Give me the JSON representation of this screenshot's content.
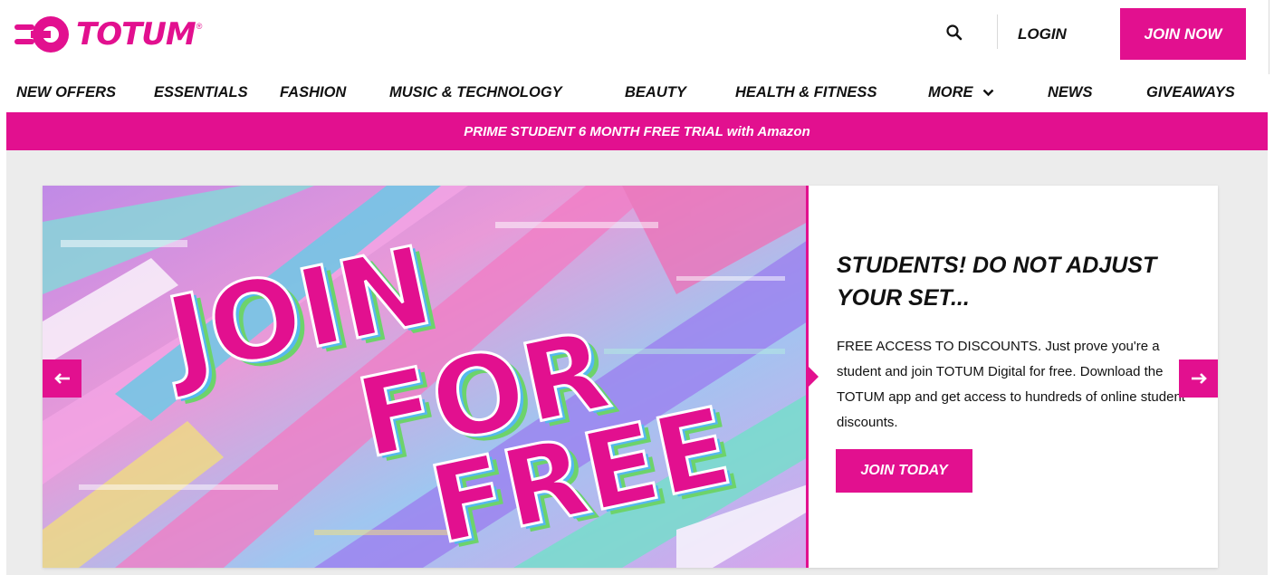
{
  "header": {
    "logo_text": "TOTUM",
    "logo_mark": "®",
    "login_label": "LOGIN",
    "join_label": "JOIN NOW"
  },
  "nav": {
    "items": [
      {
        "label": "NEW OFFERS"
      },
      {
        "label": "ESSENTIALS"
      },
      {
        "label": "FASHION"
      },
      {
        "label": "MUSIC & TECHNOLOGY"
      },
      {
        "label": "BEAUTY"
      },
      {
        "label": "HEALTH & FITNESS"
      },
      {
        "label": "MORE"
      },
      {
        "label": "NEWS"
      },
      {
        "label": "GIVEAWAYS"
      }
    ]
  },
  "promo": {
    "text": "PRIME STUDENT 6 MONTH FREE TRIAL with Amazon"
  },
  "hero": {
    "image_words": [
      "JOIN",
      "FOR",
      "FREE"
    ],
    "title": "STUDENTS! DO NOT ADJUST YOUR SET...",
    "body": "FREE ACCESS TO DISCOUNTS. Just prove you're a student and join TOTUM Digital for free. Download the TOTUM app and get access to hundreds of online student discounts.",
    "cta_label": "JOIN TODAY"
  },
  "icons": {
    "search": "search-icon",
    "chevron": "chevron-down-icon",
    "prev": "arrow-left-icon",
    "next": "arrow-right-icon"
  },
  "colors": {
    "brand": "#e2108f",
    "text": "#111111",
    "background": "#ececec"
  }
}
